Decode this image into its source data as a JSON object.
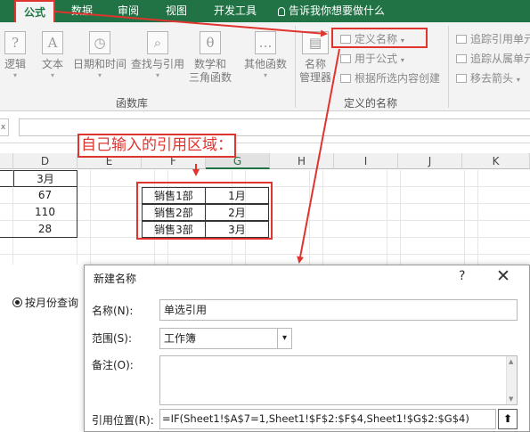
{
  "ribbon_tabs": [
    "公式",
    "数据",
    "审阅",
    "视图",
    "开发工具"
  ],
  "tell_me": "告诉我你想要做什么",
  "function_library": {
    "buttons": [
      {
        "label": "逻辑",
        "icon": "?"
      },
      {
        "label": "文本",
        "icon": "A"
      },
      {
        "label": "日期和时间",
        "icon": "◷"
      },
      {
        "label": "查找与引用",
        "icon": "⌕"
      },
      {
        "label": "数学和\n三角函数",
        "icon": "θ"
      },
      {
        "label": "其他函数",
        "icon": "…"
      }
    ],
    "group_label": "函数库"
  },
  "defined_names": {
    "name_manager": "名称\n管理器",
    "define_name": "定义名称",
    "use_in_formula": "用于公式",
    "create_from_selection": "根据所选内容创建",
    "group_label": "定义的名称"
  },
  "formula_auditing": {
    "trace_precedents": "追踪引用单元",
    "trace_dependents": "追踪从属单元",
    "remove_arrows": "移去箭头"
  },
  "formula_bar": {
    "name_box_fragment": "x"
  },
  "columns": [
    "D",
    "E",
    "F",
    "G",
    "H",
    "I",
    "J",
    "K"
  ],
  "column_d": [
    "3月",
    "67",
    "110",
    "28"
  ],
  "annotation": "自己输入的引用区域：",
  "ref_table": [
    [
      "销售1部",
      "1月"
    ],
    [
      "销售2部",
      "2月"
    ],
    [
      "销售3部",
      "3月"
    ]
  ],
  "radio_label": "按月份查询",
  "dialog": {
    "title": "新建名称",
    "help": "?",
    "close": "✕",
    "name_label": "名称(N):",
    "name_value": "单选引用",
    "scope_label": "范围(S):",
    "scope_value": "工作簿",
    "comment_label": "备注(O):",
    "refers_to_label": "引用位置(R):",
    "refers_to_value": "=IF(Sheet1!$A$7=1,Sheet1!$F$2:$F$4,Sheet1!$G$2:$G$4)"
  },
  "colors": {
    "excel_green": "#217346",
    "annotation_red": "#e0342e"
  }
}
